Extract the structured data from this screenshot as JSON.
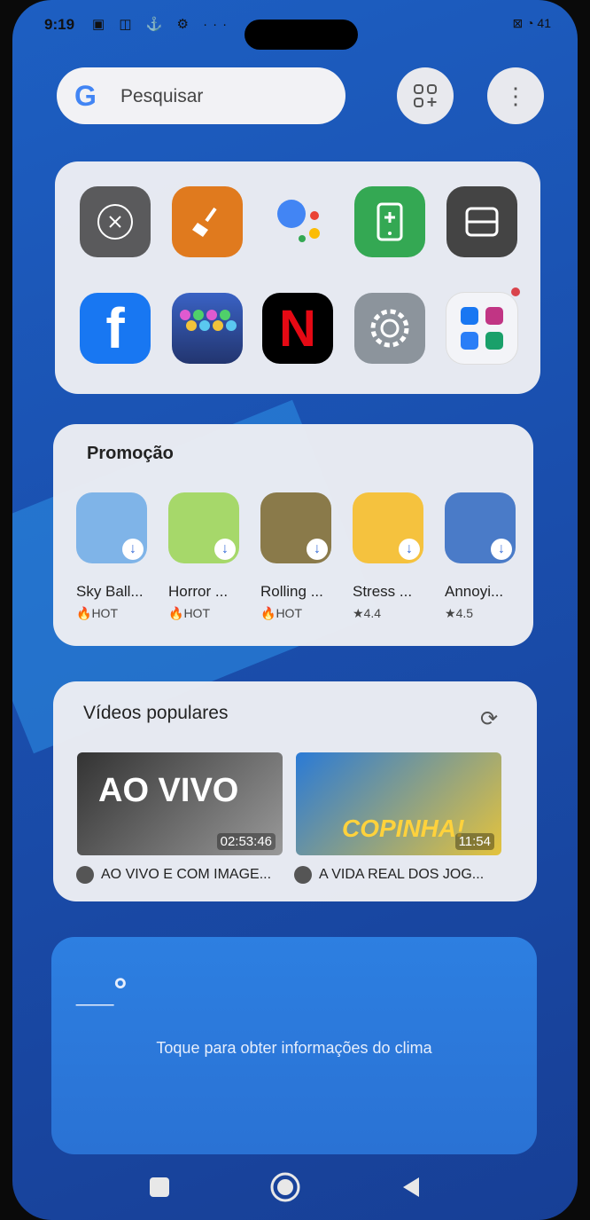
{
  "status": {
    "time": "9:19",
    "battery": "41"
  },
  "search": {
    "placeholder": "Pesquisar",
    "logo": "G"
  },
  "top_actions": [
    {
      "icon": "add-widget-icon"
    },
    {
      "icon": "more-vertical-icon"
    }
  ],
  "apps_row1": [
    {
      "name": "close-app",
      "color": "#5a5a5c"
    },
    {
      "name": "cleaner-app",
      "color": "#e07a1e"
    },
    {
      "name": "assistant-app",
      "color": "transparent"
    },
    {
      "name": "phone-manager-app",
      "color": "#34a853"
    },
    {
      "name": "dual-app",
      "color": "#444"
    }
  ],
  "apps_row2": [
    {
      "name": "facebook-app",
      "color": "#1877f2",
      "glyph": "f"
    },
    {
      "name": "bubble-game-app",
      "color": "#3b5aa8"
    },
    {
      "name": "netflix-app",
      "color": "#000",
      "glyph": "N"
    },
    {
      "name": "settings-app",
      "color": "#8c949c"
    },
    {
      "name": "social-folder",
      "color": "#f3f4f8"
    }
  ],
  "promotion": {
    "title": "Promoção",
    "games": [
      {
        "name": "Sky Ball...",
        "badge": "HOT",
        "color": "#7fb4e8"
      },
      {
        "name": "Horror ...",
        "badge": "HOT",
        "color": "#a6d86a"
      },
      {
        "name": "Rolling ...",
        "badge": "HOT",
        "color": "#8a7a4a"
      },
      {
        "name": "Stress ...",
        "badge": "4.4",
        "color": "#f5c23e"
      },
      {
        "name": "Annoyi...",
        "badge": "4.5",
        "color": "#4a7bc8"
      }
    ]
  },
  "videos": {
    "title": "Vídeos populares",
    "items": [
      {
        "caption": "AO VIVO E COM IMAGE...",
        "duration": "02:53:46",
        "text": "AO VIVO"
      },
      {
        "caption": "A VIDA REAL DOS JOG...",
        "duration": "11:54",
        "text": "COPINHA!"
      }
    ]
  },
  "weather": {
    "placeholder": "__°",
    "message": "Toque para obter informações do clima"
  },
  "nav": {
    "recents": "recents-icon",
    "home": "home-icon",
    "back": "back-icon"
  }
}
